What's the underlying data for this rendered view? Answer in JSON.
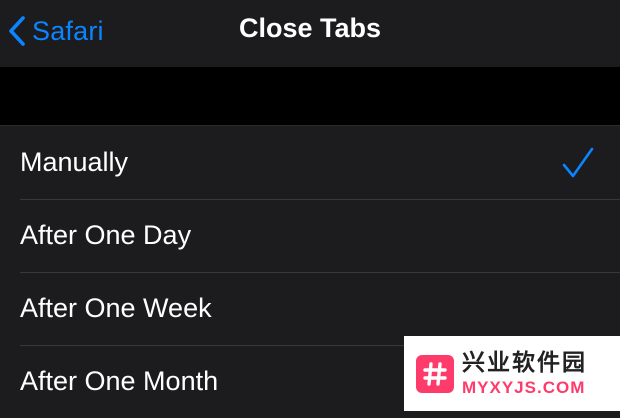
{
  "nav": {
    "back_label": "Safari",
    "title": "Close Tabs"
  },
  "options": [
    {
      "label": "Manually",
      "selected": true
    },
    {
      "label": "After One Day",
      "selected": false
    },
    {
      "label": "After One Week",
      "selected": false
    },
    {
      "label": "After One Month",
      "selected": false
    }
  ],
  "icons": {
    "back": "chevron-left-icon",
    "selected": "checkmark-icon"
  },
  "colors": {
    "accent": "#0a84ff",
    "background": "#000000",
    "cell": "#1c1c1e",
    "text": "#ffffff",
    "separator": "#38383a"
  },
  "watermark": {
    "cn_text": "兴业软件园",
    "url_text": "MYXYJS.COM"
  }
}
